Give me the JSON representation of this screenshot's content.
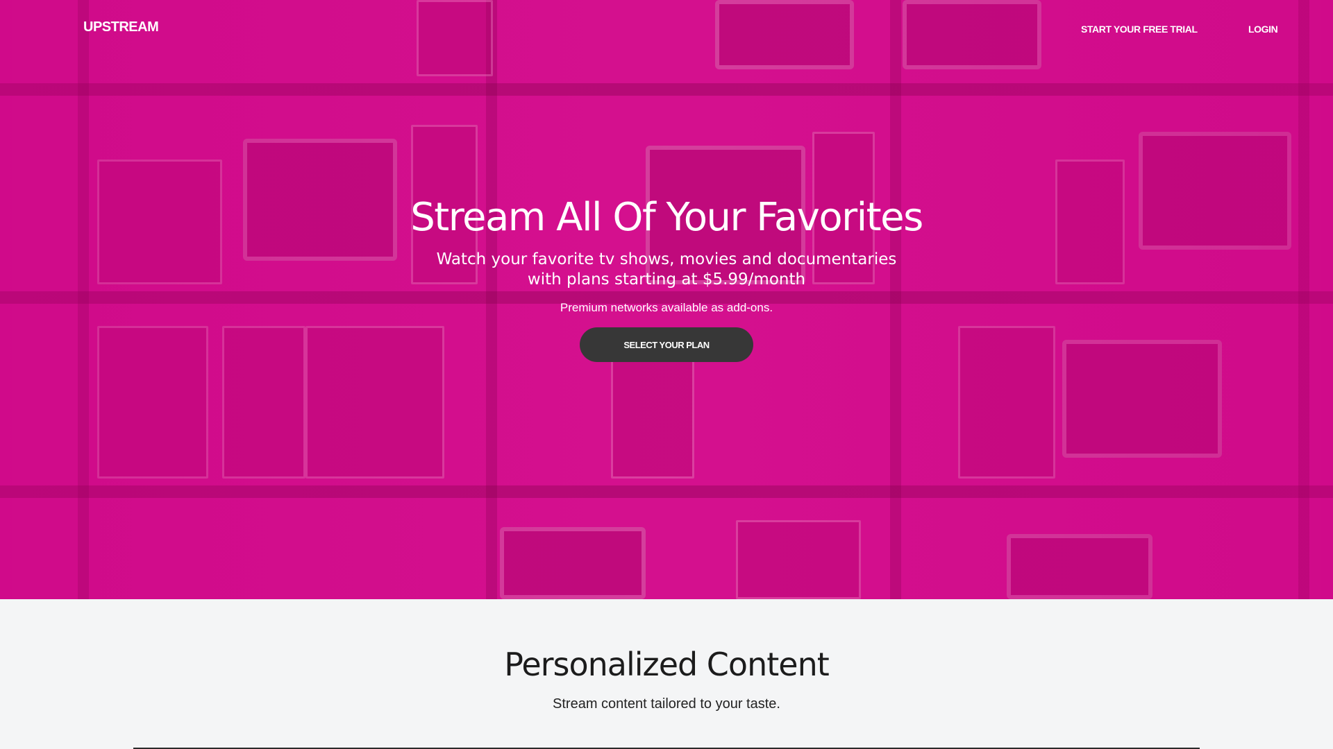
{
  "nav": {
    "logo": "UPSTREAM",
    "trial_label": "START YOUR FREE TRIAL",
    "login_label": "LOGIN"
  },
  "hero": {
    "title": "Stream All Of Your Favorites",
    "subtitle_line1": "Watch your favorite tv shows, movies and documentaries",
    "subtitle_line2": "with plans starting at $5.99/month",
    "note": "Premium networks available as add-ons.",
    "cta_label": "SELECT YOUR PLAN",
    "background_image": "magenta-tinted shelves of old computers and monitors"
  },
  "features": {
    "title": "Personalized Content",
    "subtitle": "Stream content tailored to your taste."
  },
  "colors": {
    "hero_tint": "#d4108e",
    "cta_background": "#373737",
    "page_background": "#f4f5f6",
    "text_light": "#ffffff",
    "text_dark": "#1c1c1c"
  }
}
